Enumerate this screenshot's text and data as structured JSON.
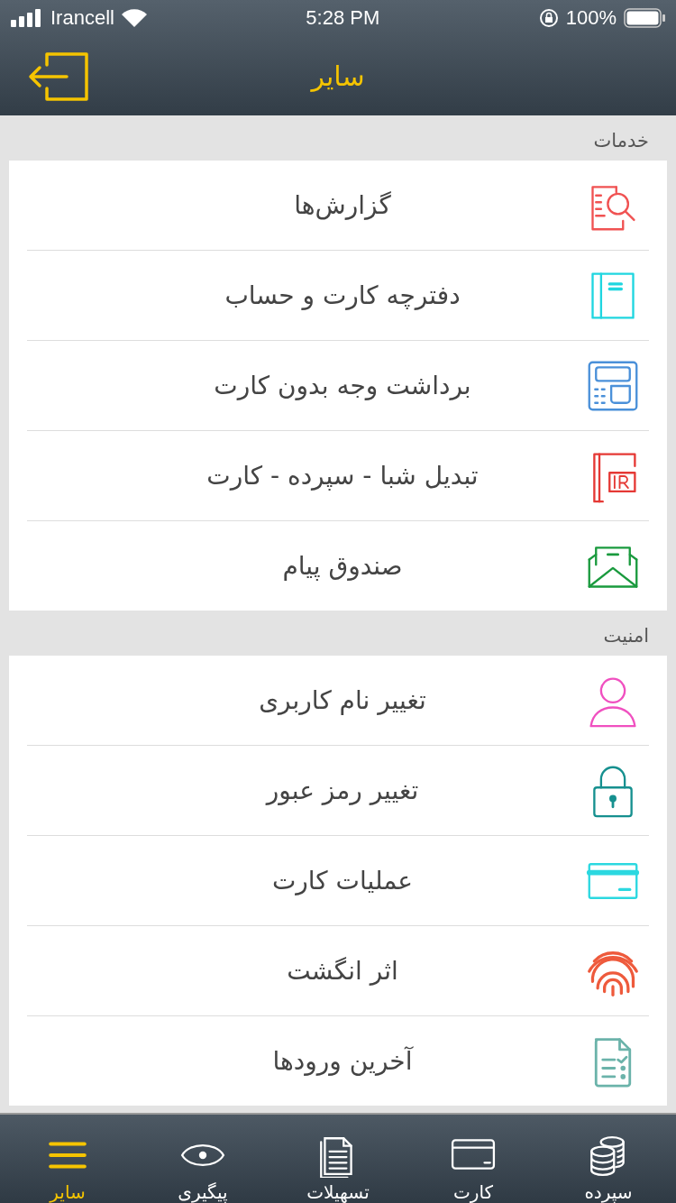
{
  "status_bar": {
    "carrier": "Irancell",
    "time": "5:28 PM",
    "battery": "100%"
  },
  "header": {
    "title": "سایر"
  },
  "sections": [
    {
      "title": "خدمات",
      "items": [
        {
          "kind": "reports",
          "label": "گزارش‌ها"
        },
        {
          "kind": "booklet",
          "label": "دفترچه کارت و حساب"
        },
        {
          "kind": "atm",
          "label": "برداشت وجه بدون کارت"
        },
        {
          "kind": "iban",
          "label": "تبدیل شبا - سپرده - کارت"
        },
        {
          "kind": "inbox",
          "label": "صندوق پیام"
        }
      ]
    },
    {
      "title": "امنیت",
      "items": [
        {
          "kind": "user",
          "label": "تغییر نام کاربری"
        },
        {
          "kind": "lock",
          "label": "تغییر رمز عبور"
        },
        {
          "kind": "card",
          "label": "عملیات کارت"
        },
        {
          "kind": "fingerprint",
          "label": "اثر انگشت"
        },
        {
          "kind": "history",
          "label": "آخرین ورودها"
        }
      ]
    }
  ],
  "tab_bar": [
    {
      "kind": "deposit",
      "label": "سپرده",
      "selected": false
    },
    {
      "kind": "card",
      "label": "کارت",
      "selected": false
    },
    {
      "kind": "loans",
      "label": "تسهیلات",
      "selected": false
    },
    {
      "kind": "track",
      "label": "پیگیری",
      "selected": false
    },
    {
      "kind": "more",
      "label": "سایر",
      "selected": true
    }
  ]
}
